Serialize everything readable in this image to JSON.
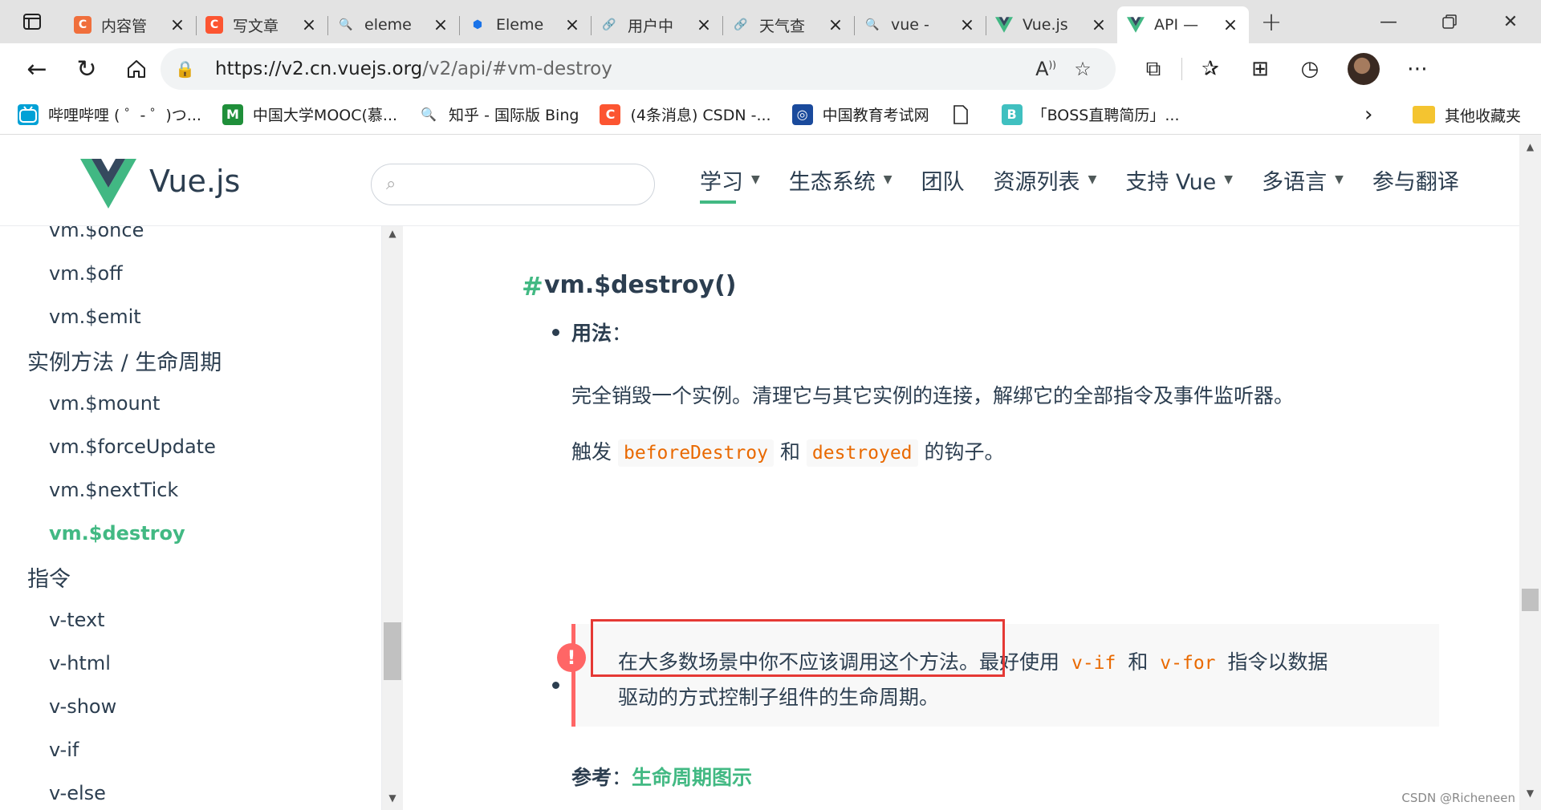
{
  "browser": {
    "tabs": [
      {
        "title": "内容管",
        "fav": "C",
        "fav_color": "#f06f3c"
      },
      {
        "title": "写文章",
        "fav": "C",
        "fav_color": "#fc5531"
      },
      {
        "title": "eleme",
        "fav": "🔍",
        "fav_color": "transparent"
      },
      {
        "title": "Eleme",
        "fav": "⬢",
        "fav_color": "transparent"
      },
      {
        "title": "用户中",
        "fav": "🔗",
        "fav_color": "transparent"
      },
      {
        "title": "天气查",
        "fav": "🔗",
        "fav_color": "transparent"
      },
      {
        "title": "vue -",
        "fav": "🔍",
        "fav_color": "transparent"
      },
      {
        "title": "Vue.js",
        "fav": "V",
        "fav_color": "transparent"
      },
      {
        "title": "API —",
        "fav": "V",
        "fav_color": "transparent"
      }
    ],
    "active_tab": 8,
    "url_host": "https://v2.cn.vuejs.org",
    "url_path": "/v2/api/#vm-destroy",
    "bookmarks": [
      {
        "label": "哔哩哔哩 ( ゜- ゜)つ...",
        "color": "#00a1d6",
        "icon": "tv"
      },
      {
        "label": "中国大学MOOC(慕...",
        "color": "#1f8f3a",
        "icon": "M"
      },
      {
        "label": "知乎 - 国际版 Bing",
        "color": "transparent",
        "icon": "🔍"
      },
      {
        "label": "(4条消息) CSDN -...",
        "color": "#fc5531",
        "icon": "C"
      },
      {
        "label": "中国教育考试网",
        "color": "#1a4a9c",
        "icon": "◎"
      },
      {
        "label": "",
        "color": "transparent",
        "icon": "page"
      },
      {
        "label": "「BOSS直聘简历」...",
        "color": "#40c0c0",
        "icon": "B"
      }
    ],
    "other_bookmarks": "其他收藏夹"
  },
  "site": {
    "logo_text": "Vue.js",
    "search_placeholder": "",
    "nav": [
      {
        "label": "学习",
        "dropdown": true,
        "active": true
      },
      {
        "label": "生态系统",
        "dropdown": true
      },
      {
        "label": "团队",
        "dropdown": false
      },
      {
        "label": "资源列表",
        "dropdown": true
      },
      {
        "label": "支持 Vue",
        "dropdown": true
      },
      {
        "label": "多语言",
        "dropdown": true
      },
      {
        "label": "参与翻译",
        "dropdown": false
      }
    ]
  },
  "sidebar": {
    "items": [
      {
        "label": "vm.$once",
        "type": "sub"
      },
      {
        "label": "vm.$off",
        "type": "sub"
      },
      {
        "label": "vm.$emit",
        "type": "sub"
      },
      {
        "label": "实例方法 / 生命周期",
        "type": "section"
      },
      {
        "label": "vm.$mount",
        "type": "sub"
      },
      {
        "label": "vm.$forceUpdate",
        "type": "sub"
      },
      {
        "label": "vm.$nextTick",
        "type": "sub"
      },
      {
        "label": "vm.$destroy",
        "type": "sub",
        "active": true
      },
      {
        "label": "指令",
        "type": "section"
      },
      {
        "label": "v-text",
        "type": "sub"
      },
      {
        "label": "v-html",
        "type": "sub"
      },
      {
        "label": "v-show",
        "type": "sub"
      },
      {
        "label": "v-if",
        "type": "sub"
      },
      {
        "label": "v-else",
        "type": "sub"
      }
    ]
  },
  "content": {
    "anchor": "#",
    "title": "vm.$destroy()",
    "usage_label": "用法",
    "colon": "：",
    "usage_text": "完全销毁一个实例。清理它与其它实例的连接，解绑它的全部指令及事件监听器。",
    "trigger_prefix": "触发",
    "trigger_code1": "beforeDestroy",
    "trigger_and": "和",
    "trigger_code2": "destroyed",
    "trigger_suffix": "的钩子。",
    "warning_icon": "!",
    "warning_highlight": "在大多数场景中你不应该调用这个方法。",
    "warning_mid": "最好使用",
    "warning_code1": "v-if",
    "warning_and": "和",
    "warning_code2": "v-for",
    "warning_end": "指令以数据",
    "warning_line2": "驱动的方式控制子组件的生命周期。",
    "ref_label": "参考",
    "ref_link": "生命周期图示"
  },
  "watermark": "CSDN @Richeneen"
}
